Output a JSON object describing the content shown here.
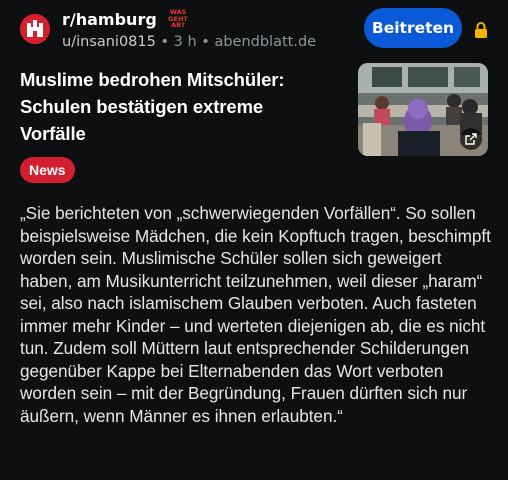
{
  "post": {
    "subreddit": "r/hamburg",
    "badge_text": "WAS GEHT AB?",
    "username": "u/insani0815",
    "separator1": "•",
    "age": "3 h",
    "separator2": "•",
    "domain": "abendblatt.de",
    "join_label": "Beitreten",
    "title": "Muslime bedrohen Mitschüler: Schulen bestätigen extreme Vorfälle",
    "flair": "News",
    "body": "„Sie berichteten von „schwerwiegenden Vorfällen“. So sollen beispielsweise Mädchen, die kein Kopftuch tragen, beschimpft worden sein. Muslimische Schüler sollen sich geweigert haben, am Musikunterricht teilzunehmen, weil dieser „haram“ sei, also nach islamischem Glauben verboten. Auch fasteten immer mehr Kinder – und werteten diejenigen ab, die es nicht tun. Zudem soll Müttern laut entsprechender Schilderungen gegenüber Kappe bei Elternabenden das Wort verboten worden sein – mit der Begründung, Frauen dürften sich nur äußern, wenn Männer es ihnen erlaubten.“"
  },
  "colors": {
    "background": "#0d0f10",
    "join_button": "#0a5ad8",
    "flair": "#d21f2f",
    "lock": "#f5b400"
  },
  "icons": {
    "avatar": "hamburg-castle-icon",
    "lock": "lock-icon",
    "external_link": "external-link-icon"
  }
}
